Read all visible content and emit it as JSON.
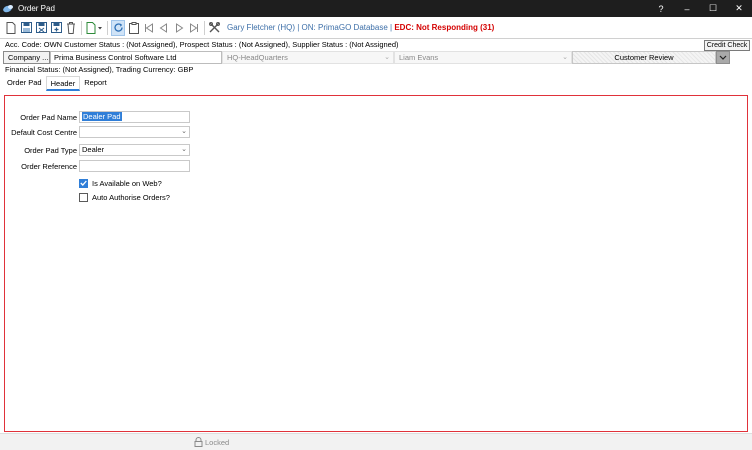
{
  "window": {
    "title": "Order Pad",
    "buttons": {
      "help": "?",
      "minimize": "–",
      "maximize": "☐",
      "close": "✕"
    }
  },
  "toolbar": {
    "user_info": "Gary Fletcher (HQ) | ON: PrimaGO Database |",
    "edc_status": "EDC: Not Responding  (31)",
    "icons": [
      "new-doc-icon",
      "save-icon",
      "save-close-icon",
      "save-new-icon",
      "delete-icon",
      "add-document-dropdown-icon",
      "refresh-icon",
      "clipboard-icon",
      "first-record-icon",
      "previous-record-icon",
      "next-record-icon",
      "last-record-icon",
      "tools-icon"
    ],
    "colors": {
      "user_info": "#3d6fa8",
      "edc_status": "#d40000",
      "active_button": "#cfe3f7"
    }
  },
  "account_info": {
    "line1": "Acc. Code: OWN  Customer Status : (Not Assigned), Prospect Status : (Not Assigned), Supplier Status : (Not Assigned)",
    "credit_check_label": "Credit Check",
    "company_button": "Company ...",
    "company_name": "Prima Business Control Software Ltd",
    "branch": "HQ-HeadQuarters",
    "contact": "Liam Evans",
    "review_status": "Customer Review",
    "line3": "Financial Status: (Not Assigned), Trading Currency: GBP"
  },
  "tabs": [
    {
      "label": "Order Pad",
      "active": false
    },
    {
      "label": "Header",
      "active": true
    },
    {
      "label": "Report",
      "active": false
    }
  ],
  "form": {
    "order_pad_name": {
      "label": "Order Pad Name",
      "value": "Dealer Pad"
    },
    "default_cost_centre": {
      "label": "Default Cost Centre",
      "value": ""
    },
    "order_pad_type": {
      "label": "Order Pad Type",
      "value": "Dealer"
    },
    "order_reference": {
      "label": "Order Reference",
      "value": ""
    },
    "available_on_web": {
      "label": "Is Available on Web?",
      "checked": true
    },
    "auto_authorise": {
      "label": "Auto Authorise Orders?",
      "checked": false
    },
    "panel_border_color": "#e0323a"
  },
  "footer": {
    "status": "Locked"
  }
}
